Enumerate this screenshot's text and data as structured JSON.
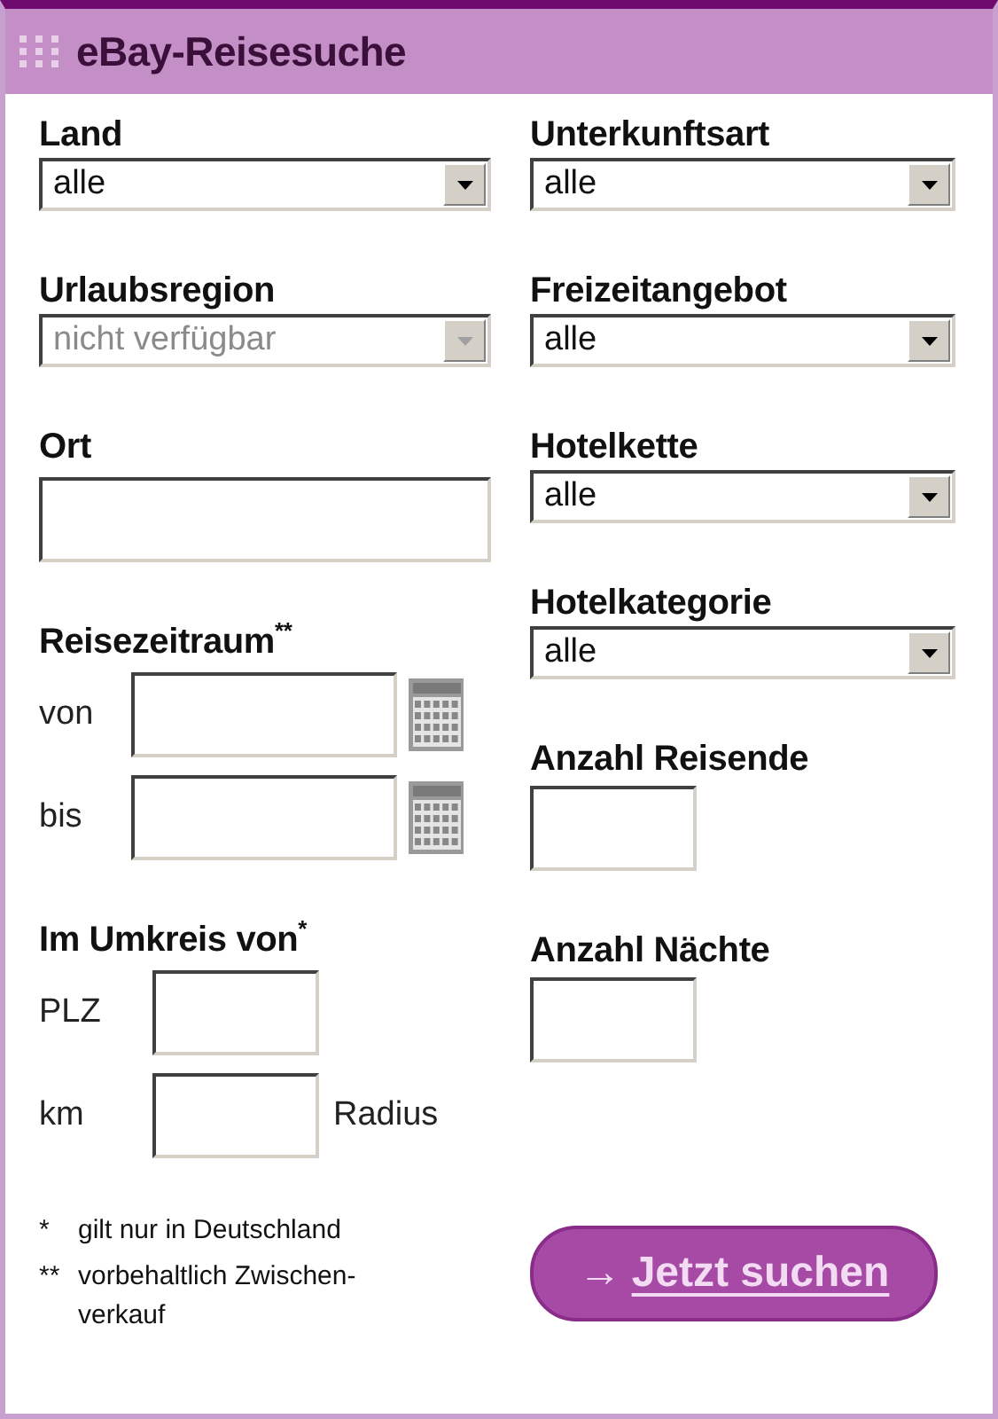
{
  "title": "eBay-Reisesuche",
  "left": [
    {
      "kind": "select",
      "label": "Land",
      "value": "alle",
      "disabled": false
    },
    {
      "kind": "select",
      "label": "Urlaubsregion",
      "value": "nicht verfügbar",
      "disabled": true
    },
    {
      "kind": "text",
      "label": "Ort"
    },
    {
      "kind": "dates",
      "label": "Reisezeitraum$^{**}$",
      "rows": [
        {
          "label": "von"
        },
        {
          "label": "bis"
        }
      ]
    },
    {
      "kind": "area",
      "label": "Im Umkreis von$^{*}$",
      "rows": [
        {
          "label": "PLZ"
        },
        {
          "label": "km",
          "suffix": "Radius"
        }
      ]
    }
  ],
  "right": [
    {
      "kind": "select",
      "label": "Unterkunftsart",
      "value": "alle",
      "disabled": false
    },
    {
      "kind": "select",
      "label": "Freizeitangebot",
      "value": "alle",
      "disabled": false
    },
    {
      "kind": "select",
      "label": "Hotelkette",
      "value": "alle",
      "disabled": false
    },
    {
      "kind": "select",
      "label": "Hotelkategorie",
      "value": "alle",
      "disabled": false
    },
    {
      "kind": "small",
      "label": "Anzahl Reisende"
    },
    {
      "kind": "small",
      "label": "Anzahl Nächte"
    }
  ],
  "footnotes": [
    {
      "mark": "*",
      "lines": [
        "gilt nur in Deutschland"
      ]
    },
    {
      "mark": "**",
      "lines": [
        "vorbehaltlich Zwischen-",
        "verkauf"
      ]
    }
  ],
  "button": {
    "arrow": "→",
    "label": "Jetzt suchen"
  }
}
